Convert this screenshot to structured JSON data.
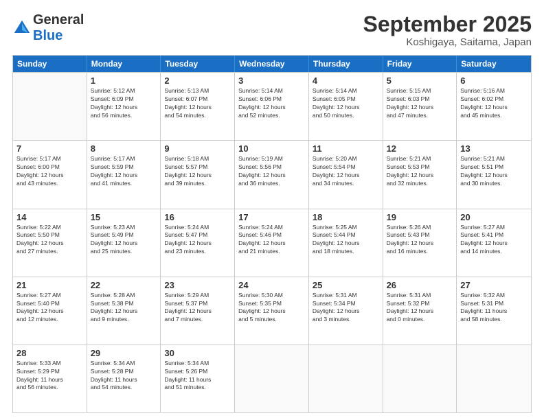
{
  "header": {
    "logo_general": "General",
    "logo_blue": "Blue",
    "month_title": "September 2025",
    "location": "Koshigaya, Saitama, Japan"
  },
  "days_of_week": [
    "Sunday",
    "Monday",
    "Tuesday",
    "Wednesday",
    "Thursday",
    "Friday",
    "Saturday"
  ],
  "weeks": [
    [
      {
        "day": null,
        "info": ""
      },
      {
        "day": "1",
        "info": "Sunrise: 5:12 AM\nSunset: 6:09 PM\nDaylight: 12 hours\nand 56 minutes."
      },
      {
        "day": "2",
        "info": "Sunrise: 5:13 AM\nSunset: 6:07 PM\nDaylight: 12 hours\nand 54 minutes."
      },
      {
        "day": "3",
        "info": "Sunrise: 5:14 AM\nSunset: 6:06 PM\nDaylight: 12 hours\nand 52 minutes."
      },
      {
        "day": "4",
        "info": "Sunrise: 5:14 AM\nSunset: 6:05 PM\nDaylight: 12 hours\nand 50 minutes."
      },
      {
        "day": "5",
        "info": "Sunrise: 5:15 AM\nSunset: 6:03 PM\nDaylight: 12 hours\nand 47 minutes."
      },
      {
        "day": "6",
        "info": "Sunrise: 5:16 AM\nSunset: 6:02 PM\nDaylight: 12 hours\nand 45 minutes."
      }
    ],
    [
      {
        "day": "7",
        "info": "Sunrise: 5:17 AM\nSunset: 6:00 PM\nDaylight: 12 hours\nand 43 minutes."
      },
      {
        "day": "8",
        "info": "Sunrise: 5:17 AM\nSunset: 5:59 PM\nDaylight: 12 hours\nand 41 minutes."
      },
      {
        "day": "9",
        "info": "Sunrise: 5:18 AM\nSunset: 5:57 PM\nDaylight: 12 hours\nand 39 minutes."
      },
      {
        "day": "10",
        "info": "Sunrise: 5:19 AM\nSunset: 5:56 PM\nDaylight: 12 hours\nand 36 minutes."
      },
      {
        "day": "11",
        "info": "Sunrise: 5:20 AM\nSunset: 5:54 PM\nDaylight: 12 hours\nand 34 minutes."
      },
      {
        "day": "12",
        "info": "Sunrise: 5:21 AM\nSunset: 5:53 PM\nDaylight: 12 hours\nand 32 minutes."
      },
      {
        "day": "13",
        "info": "Sunrise: 5:21 AM\nSunset: 5:51 PM\nDaylight: 12 hours\nand 30 minutes."
      }
    ],
    [
      {
        "day": "14",
        "info": "Sunrise: 5:22 AM\nSunset: 5:50 PM\nDaylight: 12 hours\nand 27 minutes."
      },
      {
        "day": "15",
        "info": "Sunrise: 5:23 AM\nSunset: 5:49 PM\nDaylight: 12 hours\nand 25 minutes."
      },
      {
        "day": "16",
        "info": "Sunrise: 5:24 AM\nSunset: 5:47 PM\nDaylight: 12 hours\nand 23 minutes."
      },
      {
        "day": "17",
        "info": "Sunrise: 5:24 AM\nSunset: 5:46 PM\nDaylight: 12 hours\nand 21 minutes."
      },
      {
        "day": "18",
        "info": "Sunrise: 5:25 AM\nSunset: 5:44 PM\nDaylight: 12 hours\nand 18 minutes."
      },
      {
        "day": "19",
        "info": "Sunrise: 5:26 AM\nSunset: 5:43 PM\nDaylight: 12 hours\nand 16 minutes."
      },
      {
        "day": "20",
        "info": "Sunrise: 5:27 AM\nSunset: 5:41 PM\nDaylight: 12 hours\nand 14 minutes."
      }
    ],
    [
      {
        "day": "21",
        "info": "Sunrise: 5:27 AM\nSunset: 5:40 PM\nDaylight: 12 hours\nand 12 minutes."
      },
      {
        "day": "22",
        "info": "Sunrise: 5:28 AM\nSunset: 5:38 PM\nDaylight: 12 hours\nand 9 minutes."
      },
      {
        "day": "23",
        "info": "Sunrise: 5:29 AM\nSunset: 5:37 PM\nDaylight: 12 hours\nand 7 minutes."
      },
      {
        "day": "24",
        "info": "Sunrise: 5:30 AM\nSunset: 5:35 PM\nDaylight: 12 hours\nand 5 minutes."
      },
      {
        "day": "25",
        "info": "Sunrise: 5:31 AM\nSunset: 5:34 PM\nDaylight: 12 hours\nand 3 minutes."
      },
      {
        "day": "26",
        "info": "Sunrise: 5:31 AM\nSunset: 5:32 PM\nDaylight: 12 hours\nand 0 minutes."
      },
      {
        "day": "27",
        "info": "Sunrise: 5:32 AM\nSunset: 5:31 PM\nDaylight: 11 hours\nand 58 minutes."
      }
    ],
    [
      {
        "day": "28",
        "info": "Sunrise: 5:33 AM\nSunset: 5:29 PM\nDaylight: 11 hours\nand 56 minutes."
      },
      {
        "day": "29",
        "info": "Sunrise: 5:34 AM\nSunset: 5:28 PM\nDaylight: 11 hours\nand 54 minutes."
      },
      {
        "day": "30",
        "info": "Sunrise: 5:34 AM\nSunset: 5:26 PM\nDaylight: 11 hours\nand 51 minutes."
      },
      {
        "day": null,
        "info": ""
      },
      {
        "day": null,
        "info": ""
      },
      {
        "day": null,
        "info": ""
      },
      {
        "day": null,
        "info": ""
      }
    ]
  ]
}
